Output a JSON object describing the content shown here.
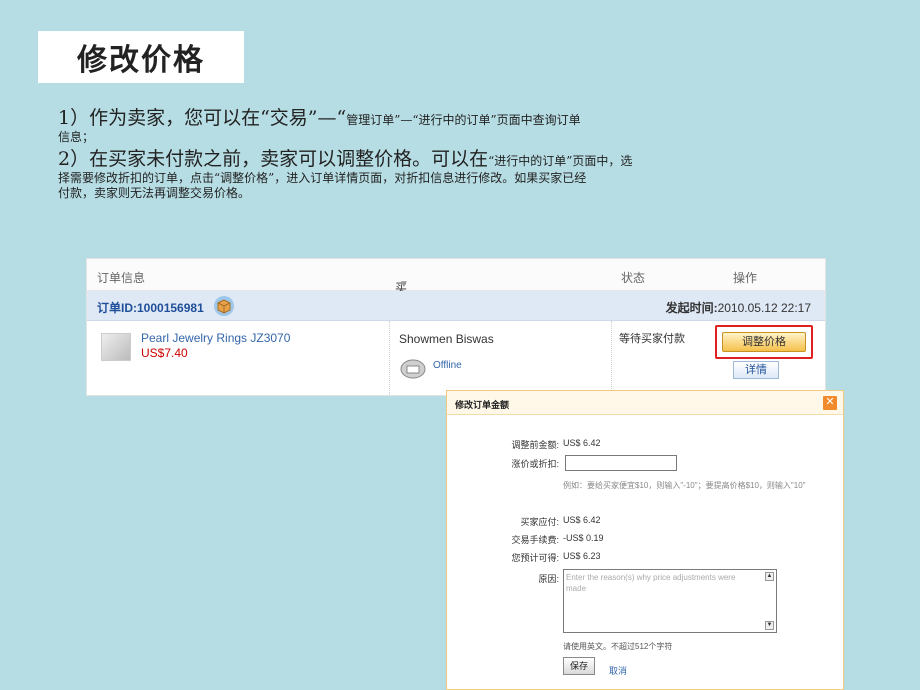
{
  "slide": {
    "title": "修改价格",
    "line1_num": "1）",
    "line1_big": "作为卖家，您可以在“交易”—“",
    "line1_small": "管理订单”—“进行中的订单”页面中查询订单",
    "line1_tail": "信息；",
    "line2_big": "2）在买家未付款之前，卖家可以调整价格。可以在",
    "line2_small": "“进行中的订单”页面中，选",
    "line2_rest1": "择需要修改折扣的订单，点击“调整价格”，进入订单详情页面，对折扣信息进行修改。如果买家已经",
    "line2_rest2": "付款，卖家则无法再调整交易价格。"
  },
  "orders": {
    "col_info": "订单信息",
    "col_buyer": "买家",
    "col_status": "状态",
    "col_action": "操作",
    "order_id_label": "订单ID:",
    "order_id": "1000156981",
    "time_label": "发起时间:",
    "time_value": "2010.05.12 22:17",
    "product_name": "Pearl Jewelry Rings JZ3070",
    "product_price": "US$7.40",
    "buyer_name": "Showmen Biswas",
    "buyer_status": "Offline",
    "order_status": "等待买家付款",
    "adjust_label": "调整价格",
    "detail_label": "详情"
  },
  "modal": {
    "title": "修改订单金额",
    "close": "✕",
    "before_label": "调整前金额:",
    "before_value": "US$ 6.42",
    "discount_label": "涨价或折扣:",
    "example": "例如：要给买家便宜$10，则输入\"-10\"；要提高价格$10，则输入\"10\"",
    "payable_label": "买家应付:",
    "payable_value": "US$ 6.42",
    "fee_label": "交易手续费:",
    "fee_value": "-US$ 0.19",
    "expected_label": "您预计可得:",
    "expected_value": "US$ 6.23",
    "reason_label": "原因:",
    "reason_placeholder": "Enter the reason(s) why price adjustments were made",
    "hint": "请使用英文。不超过512个字符",
    "save_label": "保存",
    "cancel_label": "取消"
  }
}
